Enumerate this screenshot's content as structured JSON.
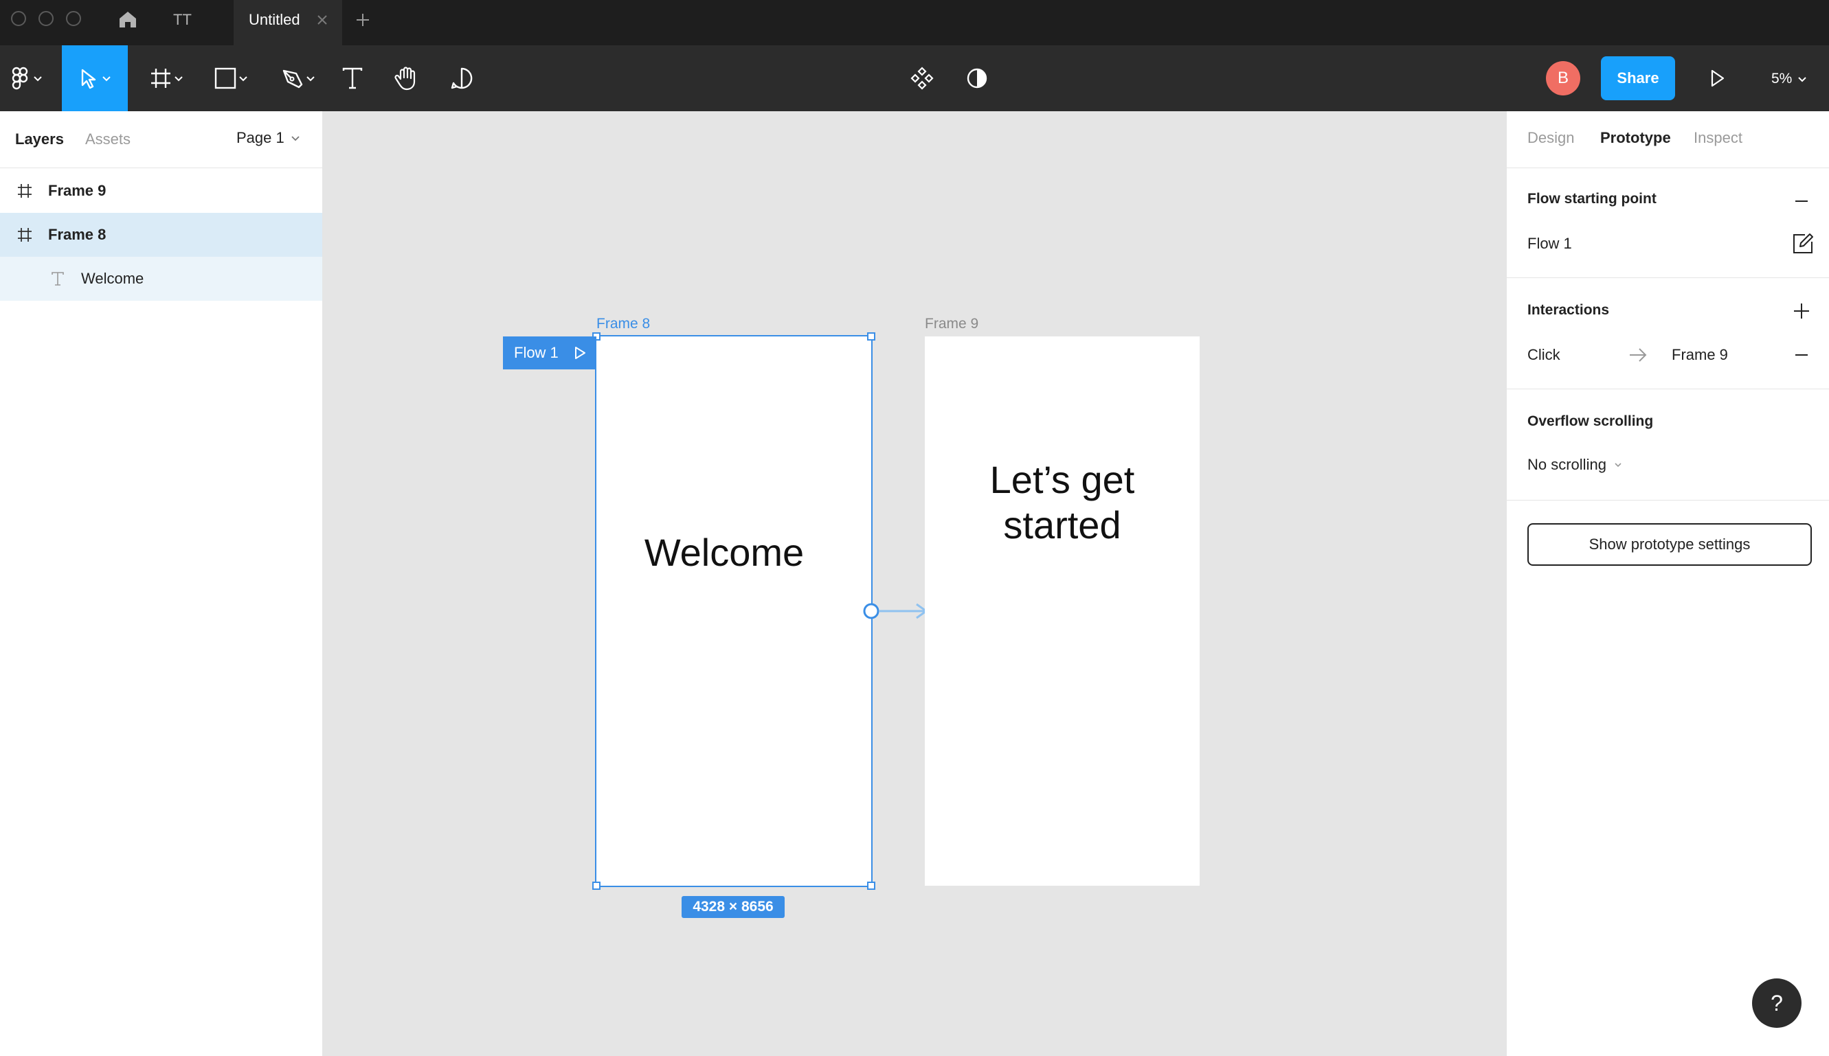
{
  "titlebar": {
    "tabs": [
      {
        "label": "TT"
      },
      {
        "label": "Untitled"
      }
    ]
  },
  "toolbar": {
    "avatar_letter": "B",
    "share_label": "Share",
    "zoom": "5%"
  },
  "left_panel": {
    "tab_layers": "Layers",
    "tab_assets": "Assets",
    "page": "Page 1",
    "layers": [
      {
        "label": "Frame 9"
      },
      {
        "label": "Frame 8"
      },
      {
        "label": "Welcome"
      }
    ]
  },
  "canvas": {
    "frame8": {
      "label": "Frame 8",
      "text": "Welcome",
      "size": "4328 × 8656"
    },
    "frame9": {
      "label": "Frame 9",
      "text_line1": "Let’s get",
      "text_line2": "started"
    },
    "flow_badge": "Flow 1"
  },
  "right_panel": {
    "tabs": [
      "Design",
      "Prototype",
      "Inspect"
    ],
    "flow_heading": "Flow starting point",
    "flow_name": "Flow 1",
    "interactions_heading": "Interactions",
    "interaction_trigger": "Click",
    "interaction_target": "Frame 9",
    "overflow_heading": "Overflow scrolling",
    "overflow_value": "No scrolling",
    "prototype_settings_button": "Show prototype settings"
  },
  "help_label": "?",
  "colors": {
    "accent": "#18a0fb",
    "selection": "#3a8ee6",
    "avatar": "#f06e63",
    "toolbar_bg": "#2c2c2c",
    "canvas_bg": "#e5e5e5"
  }
}
